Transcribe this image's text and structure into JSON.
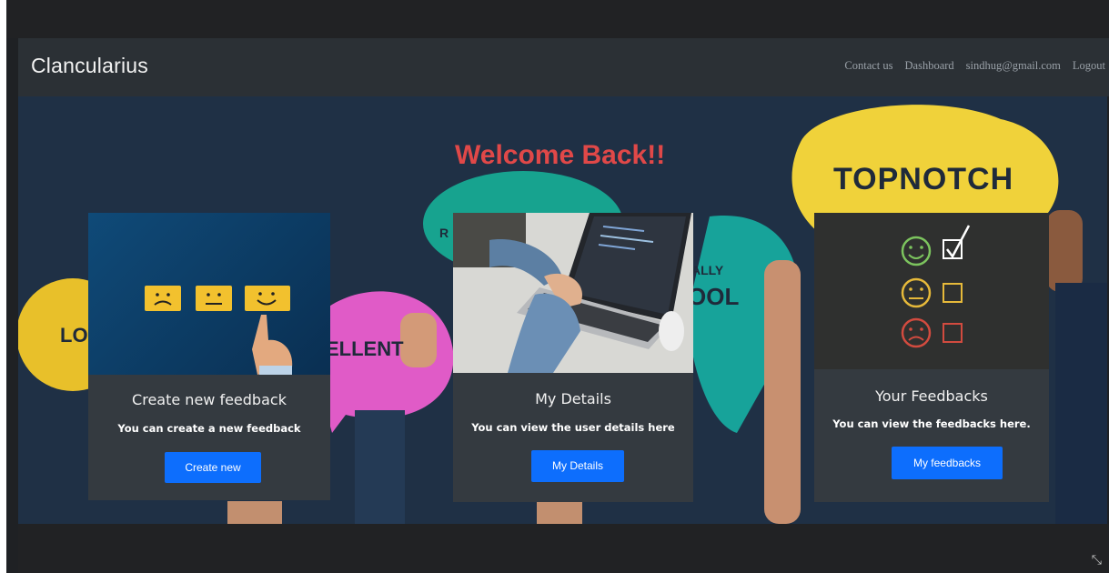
{
  "navbar": {
    "brand": "Clancularius",
    "links": [
      "Contact us",
      "Dashboard",
      "sindhug@gmail.com",
      "Logout"
    ]
  },
  "hero": {
    "welcome": "Welcome Back!!",
    "bubbles": [
      "TOPNOTCH",
      "LO",
      "ELLENT",
      "ALLY",
      "OOL",
      "R"
    ]
  },
  "cards": [
    {
      "title": "Create new feedback",
      "desc": "You can create a new feedback",
      "button": "Create new"
    },
    {
      "title": "My Details",
      "desc": "You can view the user details here",
      "button": "My Details"
    },
    {
      "title": "Your Feedbacks",
      "desc": "You can view the feedbacks here.",
      "button": "My feedbacks"
    }
  ],
  "colors": {
    "navbar_bg": "#2b3035",
    "hero_bg": "#1f3045",
    "welcome": "#e04848",
    "card_bg": "#343a40",
    "button": "#0d6efd"
  }
}
